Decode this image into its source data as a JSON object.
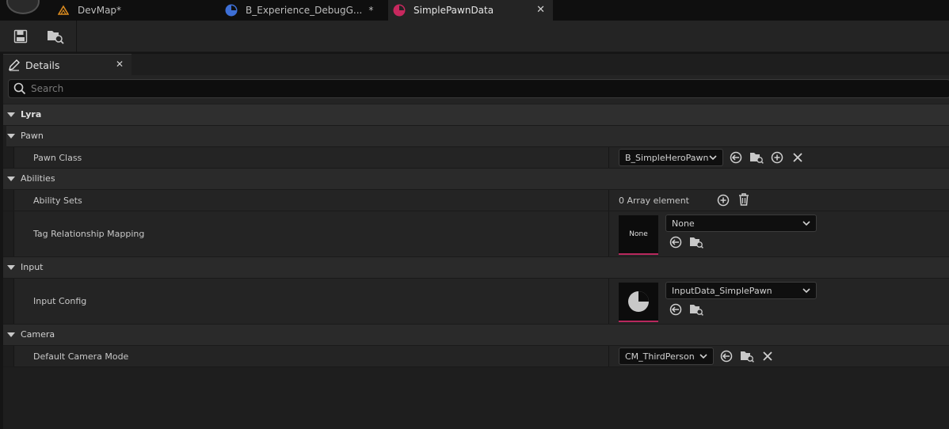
{
  "tabs": [
    {
      "label": "DevMap*",
      "dirty": "",
      "icon": "level-icon",
      "color": "#d98a1f"
    },
    {
      "label": "B_Experience_DebugG...",
      "dirty": "*",
      "icon": "blueprint-icon",
      "color": "#3d6fd6"
    },
    {
      "label": "SimplePawnData",
      "dirty": "",
      "icon": "data-asset-icon",
      "color": "#c8285e"
    }
  ],
  "toolbar": {
    "save_icon": "save-icon",
    "browse_icon": "browse-icon"
  },
  "details_tab": {
    "label": "Details"
  },
  "search": {
    "placeholder": "Search",
    "value": ""
  },
  "categories": {
    "lyra": "Lyra",
    "pawn": "Pawn",
    "abilities": "Abilities",
    "input": "Input",
    "camera": "Camera"
  },
  "properties": {
    "pawn_class": {
      "label": "Pawn Class",
      "value": "B_SimpleHeroPawn"
    },
    "ability_sets": {
      "label": "Ability Sets",
      "value": "0 Array element"
    },
    "tag_relationship": {
      "label": "Tag Relationship Mapping",
      "value": "None",
      "thumb": "None"
    },
    "input_config": {
      "label": "Input Config",
      "value": "InputData_SimplePawn"
    },
    "camera_mode": {
      "label": "Default Camera Mode",
      "value": "CM_ThirdPerson"
    }
  },
  "colors": {
    "accent": "#b8285e",
    "background": "#1e1e1e",
    "tab_active": "#242424"
  }
}
